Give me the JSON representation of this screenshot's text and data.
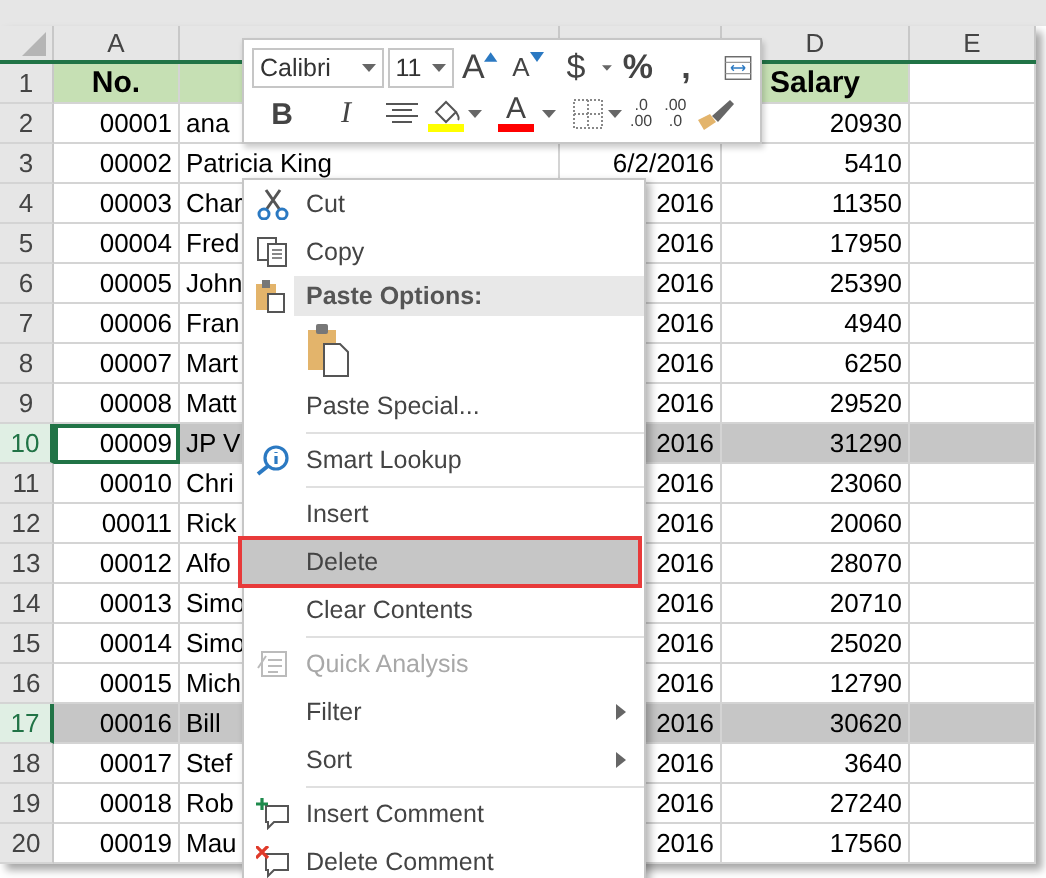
{
  "columns": [
    {
      "header": "A"
    },
    {},
    {},
    {
      "header": "D"
    },
    {
      "header": "E"
    }
  ],
  "rows": [
    {
      "number": "1",
      "kind": "heading",
      "selected": false,
      "active": false,
      "cells": [
        "No.",
        null,
        null,
        "Salary"
      ]
    },
    {
      "number": "2",
      "kind": "data",
      "selected": false,
      "active": false,
      "cells": [
        "00001",
        "ana",
        null,
        "20930"
      ]
    },
    {
      "number": "3",
      "kind": "data",
      "selected": false,
      "active": false,
      "cells": [
        "00002",
        "Patricia King",
        "6/2/2016",
        "5410"
      ]
    },
    {
      "number": "4",
      "kind": "data",
      "selected": false,
      "active": false,
      "cells": [
        "00003",
        "Char",
        "2016",
        "11350"
      ]
    },
    {
      "number": "5",
      "kind": "data",
      "selected": false,
      "active": false,
      "cells": [
        "00004",
        "Fred",
        "2016",
        "17950"
      ]
    },
    {
      "number": "6",
      "kind": "data",
      "selected": false,
      "active": false,
      "cells": [
        "00005",
        "John",
        "2016",
        "25390"
      ]
    },
    {
      "number": "7",
      "kind": "data",
      "selected": false,
      "active": false,
      "cells": [
        "00006",
        "Fran",
        "2016",
        "4940"
      ]
    },
    {
      "number": "8",
      "kind": "data",
      "selected": false,
      "active": false,
      "cells": [
        "00007",
        "Mart",
        "2016",
        "6250"
      ]
    },
    {
      "number": "9",
      "kind": "data",
      "selected": false,
      "active": false,
      "cells": [
        "00008",
        "Matt",
        "2016",
        "29520"
      ]
    },
    {
      "number": "10",
      "kind": "data",
      "selected": true,
      "active": true,
      "cells": [
        "00009",
        "JP V",
        "2016",
        "31290"
      ]
    },
    {
      "number": "11",
      "kind": "data",
      "selected": false,
      "active": false,
      "cells": [
        "00010",
        "Chri",
        "2016",
        "23060"
      ]
    },
    {
      "number": "12",
      "kind": "data",
      "selected": false,
      "active": false,
      "cells": [
        "00011",
        "Rick",
        "2016",
        "20060"
      ]
    },
    {
      "number": "13",
      "kind": "data",
      "selected": false,
      "active": false,
      "cells": [
        "00012",
        "Alfo",
        "2016",
        "28070"
      ]
    },
    {
      "number": "14",
      "kind": "data",
      "selected": false,
      "active": false,
      "cells": [
        "00013",
        "Simo",
        "2016",
        "20710"
      ]
    },
    {
      "number": "15",
      "kind": "data",
      "selected": false,
      "active": false,
      "cells": [
        "00014",
        "Simo",
        "2016",
        "25020"
      ]
    },
    {
      "number": "16",
      "kind": "data",
      "selected": false,
      "active": false,
      "cells": [
        "00015",
        "Mich",
        "2016",
        "12790"
      ]
    },
    {
      "number": "17",
      "kind": "data",
      "selected": true,
      "active": false,
      "cells": [
        "00016",
        "Bill",
        "2016",
        "30620"
      ]
    },
    {
      "number": "18",
      "kind": "data",
      "selected": false,
      "active": false,
      "cells": [
        "00017",
        "Stef",
        "2016",
        "3640"
      ]
    },
    {
      "number": "19",
      "kind": "data",
      "selected": false,
      "active": false,
      "cells": [
        "00018",
        "Rob",
        "2016",
        "27240"
      ]
    },
    {
      "number": "20",
      "kind": "data",
      "selected": false,
      "active": false,
      "cells": [
        "00019",
        "Mau",
        "2016",
        "17560"
      ]
    }
  ],
  "mini_toolbar": {
    "font": "Calibri",
    "size": "11",
    "row1": [
      {
        "kind": "grow",
        "label": "A"
      },
      {
        "kind": "shrink",
        "label": "A"
      },
      {
        "kind": "currency",
        "label": "$"
      },
      {
        "kind": "text",
        "label": "%"
      },
      {
        "kind": "text",
        "label": ","
      },
      {
        "kind": "wrap"
      }
    ],
    "row2": [
      {
        "kind": "bold",
        "label": "B"
      },
      {
        "kind": "italic",
        "label": "I"
      },
      {
        "kind": "align"
      },
      {
        "kind": "fill",
        "color": "#ffff00"
      },
      {
        "kind": "fontcolor",
        "label": "A",
        "color": "#ff0000"
      },
      {
        "kind": "borders"
      },
      {
        "kind": "decimal_more",
        "lines": [
          ".0",
          ".00"
        ]
      },
      {
        "kind": "decimal_less",
        "lines": [
          ".00",
          ".0"
        ]
      },
      {
        "kind": "painter"
      }
    ]
  },
  "context_menu": [
    {
      "kind": "cut",
      "label": "Cut",
      "selected": false,
      "disabled": false,
      "submenu": false
    },
    {
      "kind": "copy",
      "label": "Copy",
      "selected": false,
      "disabled": false,
      "submenu": false
    },
    {
      "kind": "header",
      "label": "Paste Options:"
    },
    {
      "kind": "paste"
    },
    {
      "kind": "item",
      "label": "Paste Special...",
      "selected": false,
      "disabled": false,
      "submenu": false
    },
    {
      "kind": "separator"
    },
    {
      "kind": "lookup",
      "label": "Smart Lookup",
      "selected": false,
      "disabled": false,
      "submenu": false
    },
    {
      "kind": "separator"
    },
    {
      "kind": "item",
      "label": "Insert",
      "selected": false,
      "disabled": false,
      "submenu": false
    },
    {
      "kind": "item",
      "label": "Delete",
      "selected": true,
      "disabled": false,
      "submenu": false
    },
    {
      "kind": "item",
      "label": "Clear Contents",
      "selected": false,
      "disabled": false,
      "submenu": false
    },
    {
      "kind": "separator"
    },
    {
      "kind": "analysis",
      "label": "Quick Analysis",
      "selected": false,
      "disabled": true,
      "submenu": false
    },
    {
      "kind": "item",
      "label": "Filter",
      "selected": false,
      "disabled": false,
      "submenu": true
    },
    {
      "kind": "item",
      "label": "Sort",
      "selected": false,
      "disabled": false,
      "submenu": true
    },
    {
      "kind": "separator"
    },
    {
      "kind": "comment_add",
      "label": "Insert Comment",
      "selected": false,
      "disabled": false,
      "submenu": false
    },
    {
      "kind": "comment_delete",
      "label": "Delete Comment",
      "selected": false,
      "disabled": false,
      "submenu": false
    }
  ]
}
